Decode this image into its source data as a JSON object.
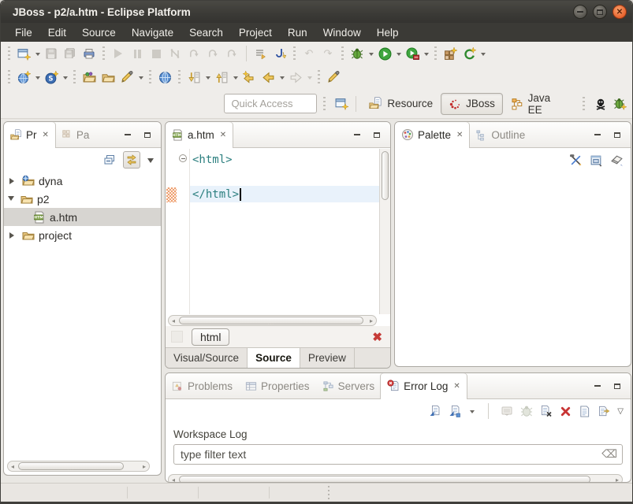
{
  "window": {
    "title": "JBoss - p2/a.htm - Eclipse Platform"
  },
  "menu": {
    "items": [
      "File",
      "Edit",
      "Source",
      "Navigate",
      "Search",
      "Project",
      "Run",
      "Window",
      "Help"
    ]
  },
  "toolbar": {
    "quick_access_placeholder": "Quick Access",
    "perspectives": {
      "resource": "Resource",
      "jboss": "JBoss",
      "java_ee": "Java EE"
    }
  },
  "explorer": {
    "tabs": {
      "project_explorer": "Pr",
      "second": "Pa"
    },
    "tree": {
      "dyna": "dyna",
      "p2": "p2",
      "a_htm": "a.htm",
      "project": "project"
    }
  },
  "editor": {
    "tab_label": "a.htm",
    "code": {
      "line1": "<html>",
      "line3": "</html>"
    },
    "breadcrumb": "html",
    "tabs": {
      "visual_source": "Visual/Source",
      "source": "Source",
      "preview": "Preview"
    }
  },
  "palette": {
    "tab_label": "Palette",
    "outline_label": "Outline"
  },
  "console": {
    "tabs": {
      "problems": "Problems",
      "properties": "Properties",
      "servers": "Servers",
      "error_log": "Error Log"
    },
    "workspace_log_label": "Workspace Log",
    "filter_placeholder": "type filter text"
  },
  "colors": {
    "titlebar": "#3B3A36",
    "close_button": "#E7632E",
    "selection": "#D7D5D1",
    "code_tag": "#2A7E7E"
  }
}
